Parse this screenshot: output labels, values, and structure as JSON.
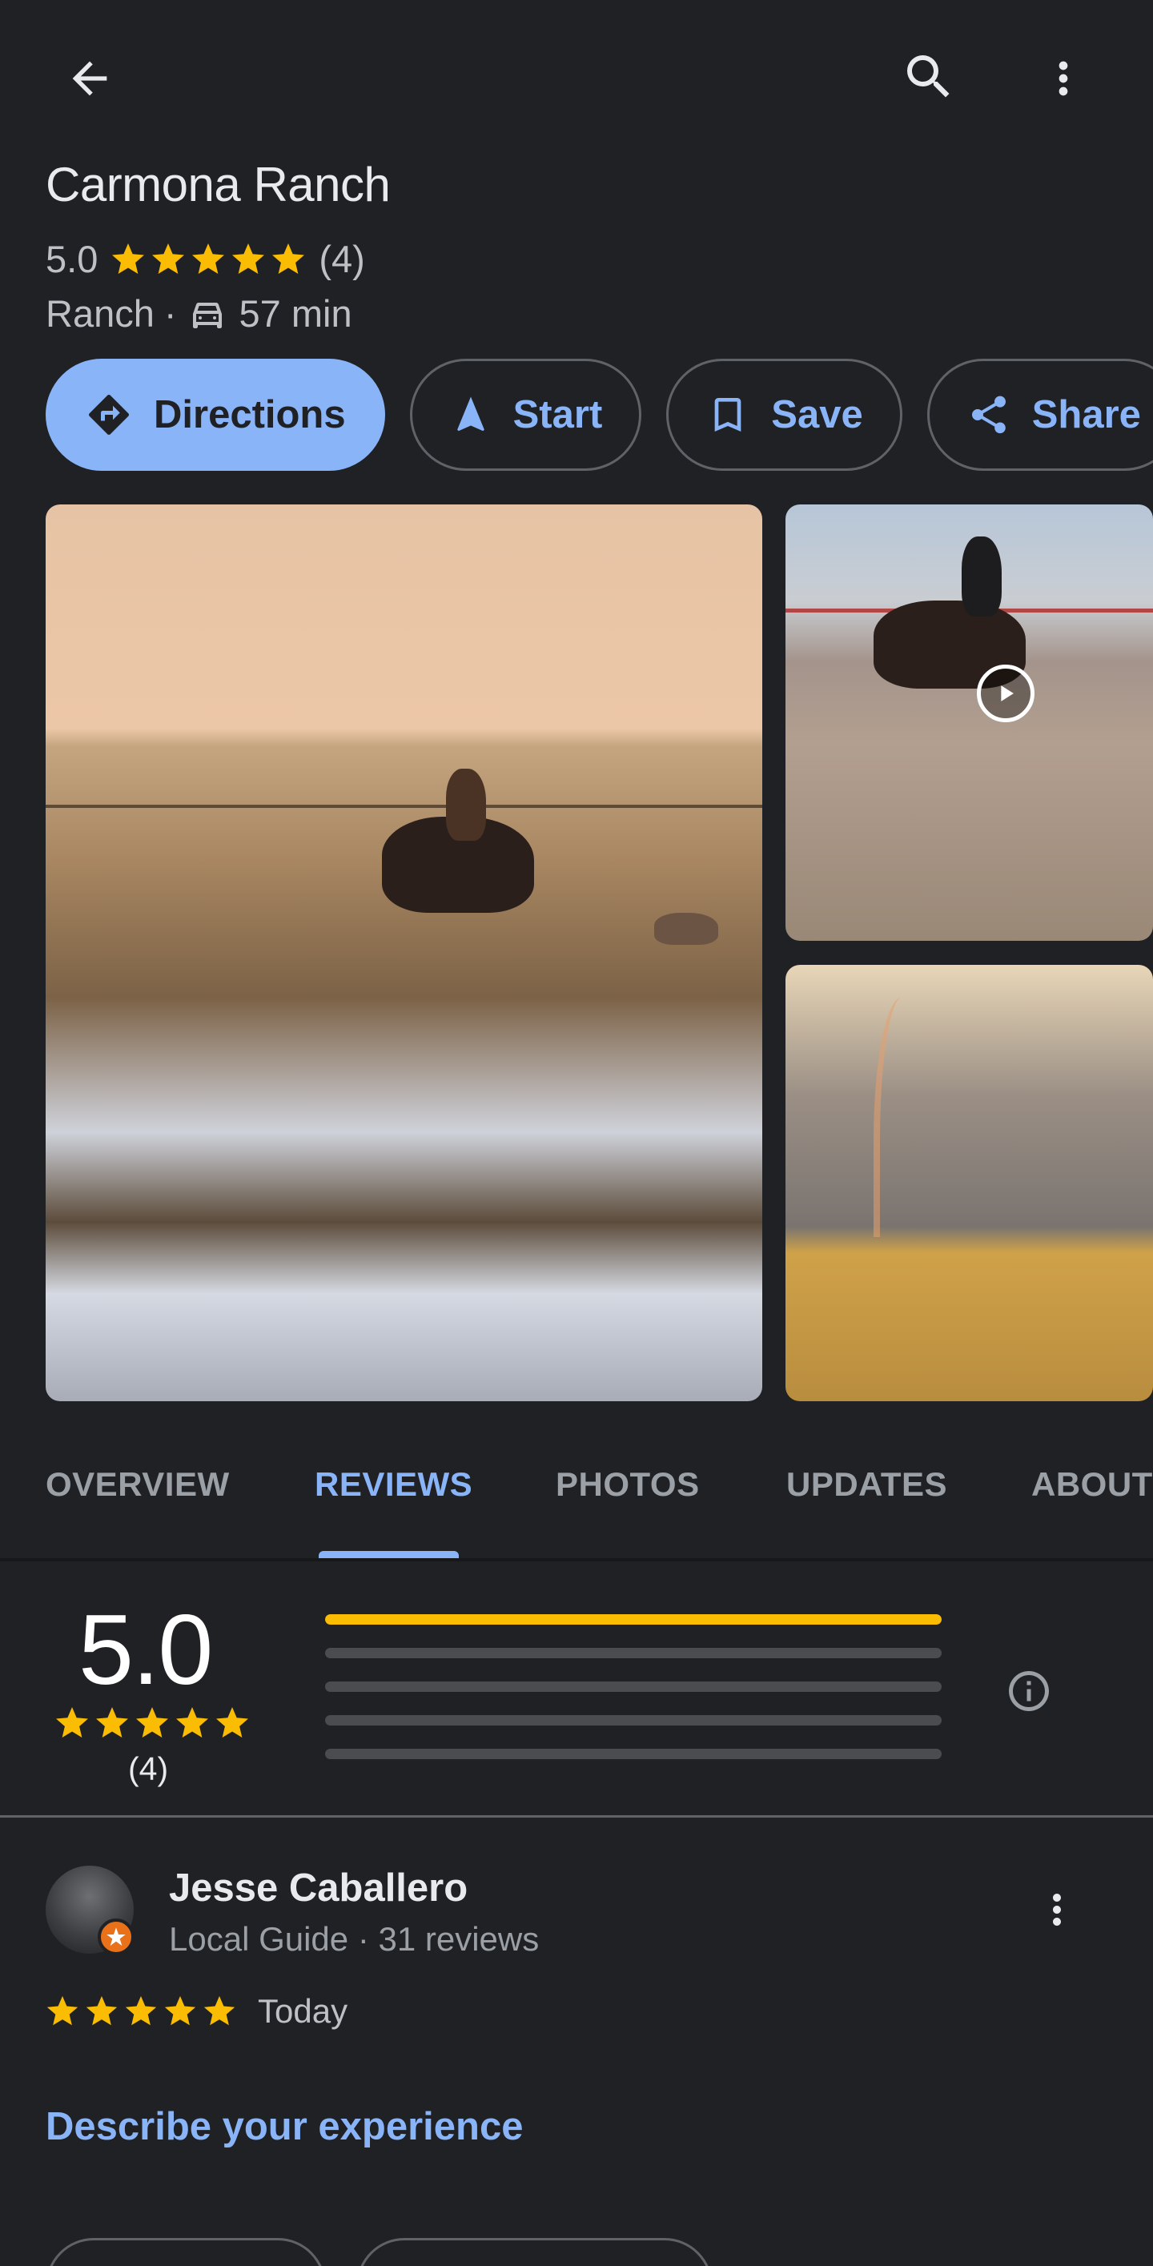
{
  "topbar": {
    "back_icon": "arrow-back-icon",
    "search_icon": "search-icon",
    "more_icon": "more-vert-icon"
  },
  "place": {
    "name": "Carmona Ranch",
    "rating": "5.0",
    "review_count": "(4)",
    "stars": 5,
    "category": "Ranch",
    "separator": "·",
    "drive_time": "57 min"
  },
  "actions": [
    {
      "label": "Directions",
      "icon": "directions-icon"
    },
    {
      "label": "Start",
      "icon": "navigation-arrow-icon"
    },
    {
      "label": "Save",
      "icon": "bookmark-icon"
    },
    {
      "label": "Share",
      "icon": "share-icon"
    }
  ],
  "tabs": [
    "OVERVIEW",
    "REVIEWS",
    "PHOTOS",
    "UPDATES",
    "ABOUT"
  ],
  "active_tab": "REVIEWS",
  "summary": {
    "rating": "5.0",
    "count": "(4)",
    "distribution": [
      1.0,
      0,
      0,
      0,
      0
    ]
  },
  "review": {
    "name": "Jesse Caballero",
    "meta": "Local Guide · 31 reviews",
    "stars": 5,
    "date": "Today",
    "cta": "Describe your experience"
  },
  "colors": {
    "background": "#202124",
    "accent": "#8ab4f8",
    "star": "#fbbc04",
    "text": "#e8eaed",
    "muted": "#9aa0a6"
  }
}
